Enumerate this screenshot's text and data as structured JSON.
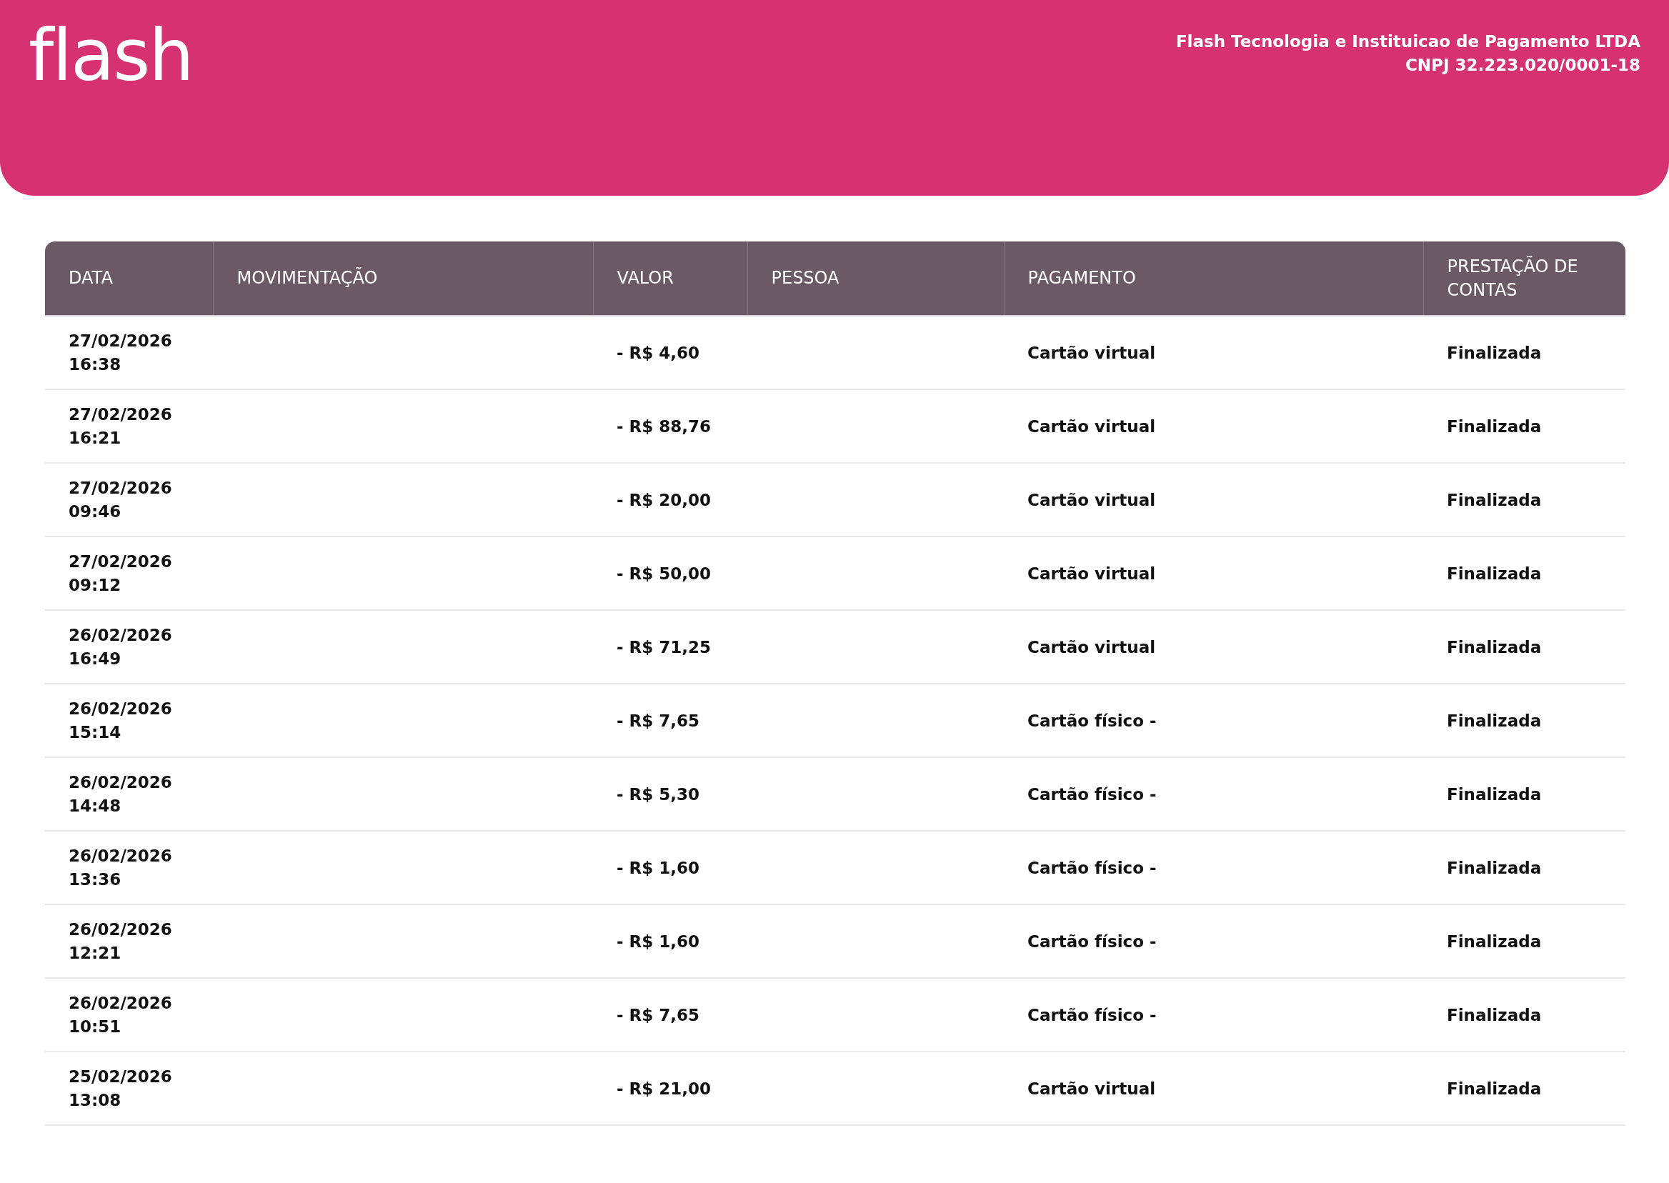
{
  "header": {
    "logo": "flash",
    "company": "Flash Tecnologia e Instituicao de Pagamento LTDA",
    "cnpj": "CNPJ 32.223.020/0001-18"
  },
  "table": {
    "columns": [
      "DATA",
      "MOVIMENTAÇÃO",
      "VALOR",
      "PESSOA",
      "PAGAMENTO",
      "PRESTAÇÃO DE CONTAS"
    ],
    "rows": [
      {
        "data": "27/02/2026\n16:38",
        "valor": "- R$ 4,60",
        "pagamento": "Cartão virtual",
        "prestacao": "Finalizada"
      },
      {
        "data": "27/02/2026\n16:21",
        "valor": "- R$ 88,76",
        "pagamento": "Cartão virtual",
        "prestacao": "Finalizada"
      },
      {
        "data": "27/02/2026\n09:46",
        "valor": "- R$ 20,00",
        "pagamento": "Cartão virtual",
        "prestacao": "Finalizada"
      },
      {
        "data": "27/02/2026\n09:12",
        "valor": "- R$ 50,00",
        "pagamento": "Cartão virtual",
        "prestacao": "Finalizada"
      },
      {
        "data": "26/02/2026\n16:49",
        "valor": "- R$ 71,25",
        "pagamento": "Cartão virtual",
        "prestacao": "Finalizada"
      },
      {
        "data": "26/02/2026\n15:14",
        "valor": "- R$ 7,65",
        "pagamento": "Cartão físico -",
        "prestacao": "Finalizada"
      },
      {
        "data": "26/02/2026\n14:48",
        "valor": "- R$ 5,30",
        "pagamento": "Cartão físico -",
        "prestacao": "Finalizada"
      },
      {
        "data": "26/02/2026\n13:36",
        "valor": "- R$ 1,60",
        "pagamento": "Cartão físico -",
        "prestacao": "Finalizada"
      },
      {
        "data": "26/02/2026\n12:21",
        "valor": "- R$ 1,60",
        "pagamento": "Cartão físico -",
        "prestacao": "Finalizada"
      },
      {
        "data": "26/02/2026\n10:51",
        "valor": "- R$ 7,65",
        "pagamento": "Cartão físico -",
        "prestacao": "Finalizada"
      },
      {
        "data": "25/02/2026\n13:08",
        "valor": "- R$ 21,00",
        "pagamento": "Cartão virtual",
        "prestacao": "Finalizada"
      }
    ]
  }
}
